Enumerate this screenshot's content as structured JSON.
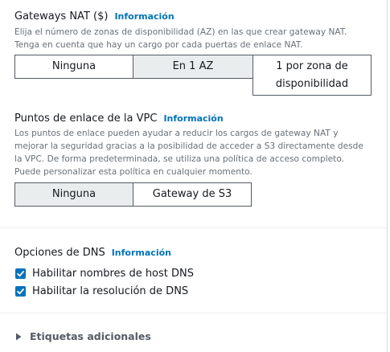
{
  "nat": {
    "title": "Gateways NAT ($)",
    "info": "Información",
    "desc_line1": "Elija el número de zonas de disponibilidad (AZ) en las que crear gateway NAT.",
    "desc_line2": "Tenga en cuenta que hay un cargo por cada puertas de enlace NAT.",
    "options": [
      "Ninguna",
      "En 1 AZ",
      "1 por zona de disponibilidad"
    ],
    "option3_line1": "1 por zona de",
    "option3_line2": "disponibilidad",
    "selected": "En 1 AZ"
  },
  "vpce": {
    "title": "Puntos de enlace de la VPC",
    "info": "Información",
    "desc_line1": "Los puntos de enlace pueden ayudar a reducir los cargos de gateway NAT y",
    "desc_line2": "mejorar la seguridad gracias a la posibilidad de acceder a S3 directamente desde",
    "desc_line3": "la VPC. De forma predeterminada, se utiliza una política de acceso completo.",
    "desc_line4": "Puede personalizar esta política en cualquier momento.",
    "options": [
      "Ninguna",
      "Gateway de S3"
    ],
    "selected": "Ninguna"
  },
  "dns": {
    "title": "Opciones de DNS",
    "info": "Información",
    "checkbox1": "Habilitar nombres de host DNS",
    "checkbox2": "Habilitar la resolución de DNS",
    "checkbox1_checked": true,
    "checkbox2_checked": true
  },
  "tags": {
    "label": "Etiquetas adicionales",
    "icon": "caret-right-icon"
  },
  "colors": {
    "accent": "#0073bb",
    "selected_bg": "#eaeded",
    "text": "#16191f",
    "muted": "#687078"
  }
}
